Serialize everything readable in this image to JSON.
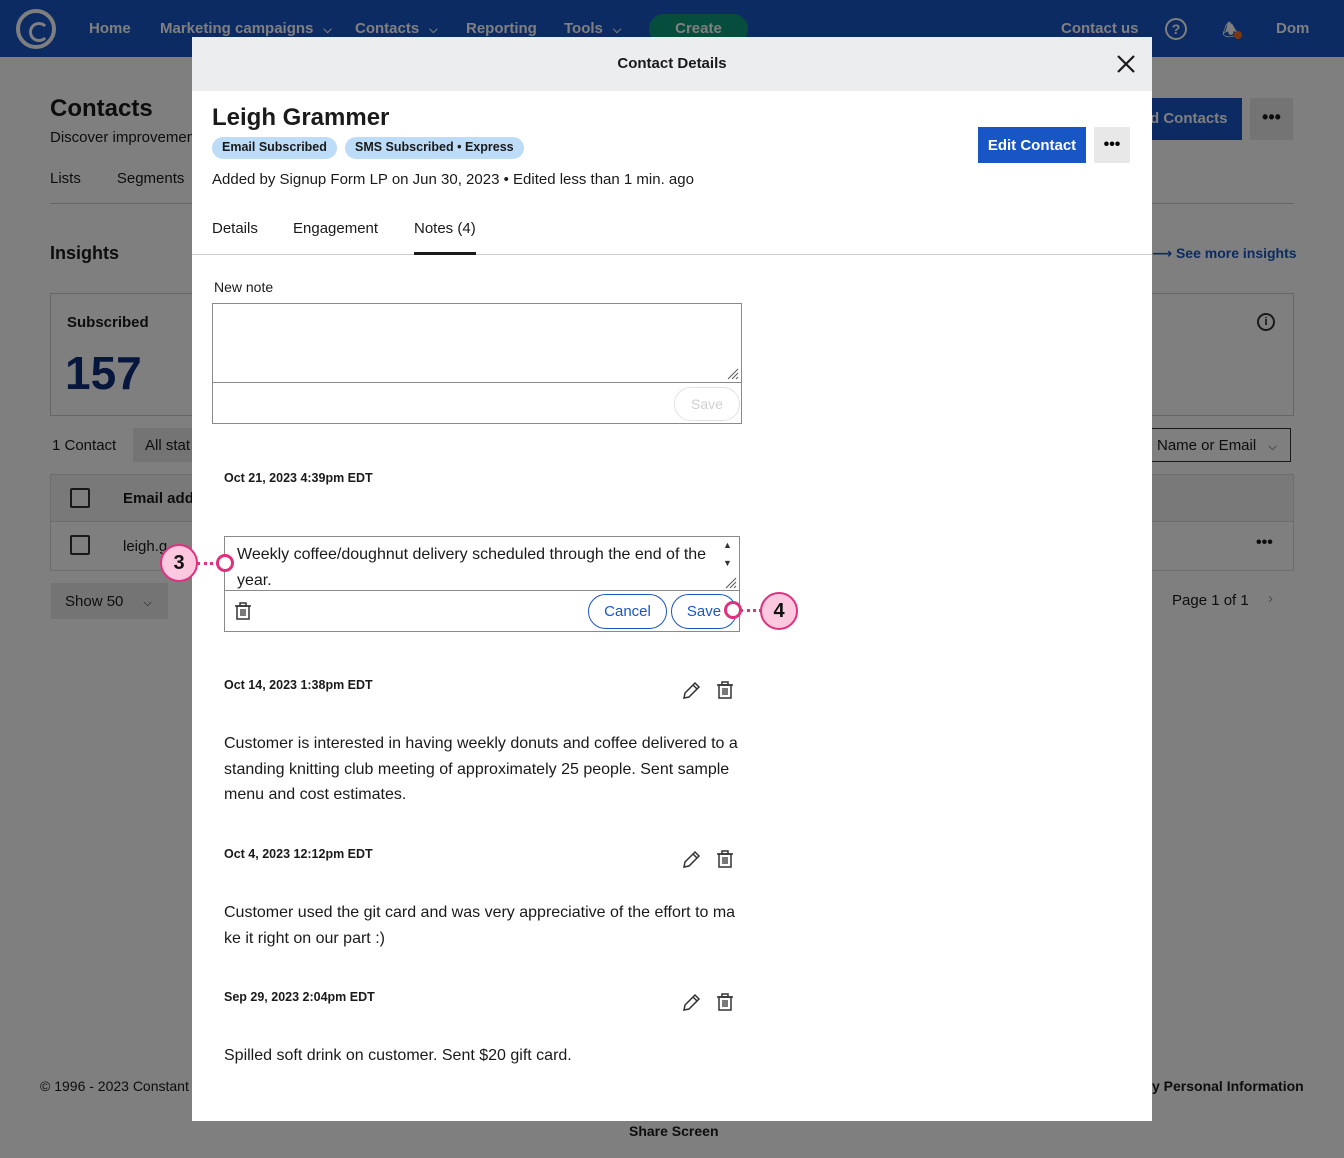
{
  "topnav": {
    "items": [
      {
        "label": "Home"
      },
      {
        "label": "Marketing campaigns"
      },
      {
        "label": "Contacts"
      },
      {
        "label": "Reporting"
      },
      {
        "label": "Tools"
      }
    ],
    "create_label": "Create",
    "contact_us": "Contact us",
    "user": "Dom"
  },
  "background": {
    "page_title": "Contacts",
    "page_subtitle": "Discover improvemen",
    "tabs": [
      "Lists",
      "Segments"
    ],
    "add_contacts_label": "d Contacts",
    "insights_title": "Insights",
    "see_more_label": "See more insights",
    "subscribed_label": "Subscribed",
    "subscribed_value": "157",
    "contact_count": "1 Contact",
    "status_filter": "All stat",
    "search_by": "Name or Email",
    "col_email": "Email addr",
    "row_email": "leigh.g",
    "show_label": "Show 50",
    "pager": "Page 1 of 1",
    "copyright": "© 1996 - 2023 Constant",
    "personal_info": "y Personal Information",
    "share_screen": "Share Screen"
  },
  "modal": {
    "title": "Contact Details",
    "contact_name": "Leigh Grammer",
    "badges": [
      "Email Subscribed",
      "SMS Subscribed • Express"
    ],
    "added_by": "Added by Signup Form LP on Jun 30, 2023 • Edited less than 1 min. ago",
    "edit_contact_label": "Edit Contact",
    "more_label": "•••",
    "tabs": [
      {
        "label": "Details",
        "active": false
      },
      {
        "label": "Engagement",
        "active": false
      },
      {
        "label": "Notes (4)",
        "active": true
      }
    ],
    "new_note": {
      "label": "New note",
      "value": "",
      "save_label": "Save"
    },
    "notes": [
      {
        "date": "Oct 21, 2023 4:39pm EDT",
        "editing": true,
        "text": "Weekly coffee/doughnut delivery scheduled through the end of the year.",
        "cancel_label": "Cancel",
        "save_label": "Save"
      },
      {
        "date": "Oct 14, 2023 1:38pm EDT",
        "text": "Customer is interested in having weekly donuts and coffee delivered to a standing knitting club meeting of approximately 25 people. Sent sample menu and cost estimates."
      },
      {
        "date": "Oct 4, 2023 12:12pm EDT",
        "text": "Customer used the git card and was very appreciative of the effort to make it right on our part :)"
      },
      {
        "date": "Sep 29, 2023 2:04pm EDT",
        "text": "Spilled soft drink on customer. Sent $20 gift card."
      }
    ]
  },
  "callouts": [
    "3",
    "4"
  ],
  "colors": {
    "brand_blue": "#1856c5",
    "create_green": "#0f9a7d",
    "badge_blue": "#bcdcf8",
    "callout_pink": "#e0307e"
  }
}
